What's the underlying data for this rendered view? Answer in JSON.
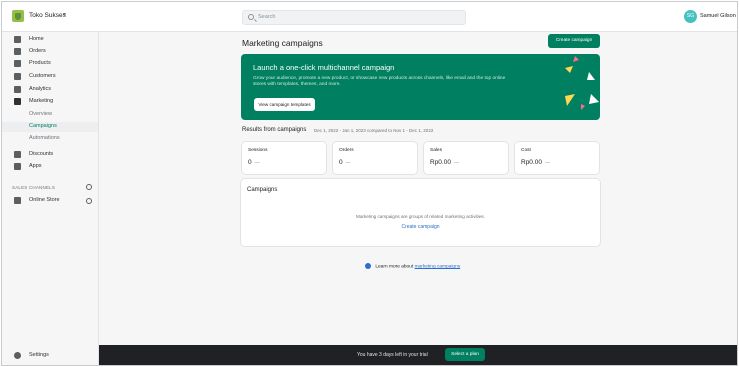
{
  "header": {
    "store_name": "Toko Sukses",
    "store_caret": "▾",
    "search_placeholder": "Search",
    "user_initials": "SG",
    "user_name": "Samuel Gilson"
  },
  "sidebar": {
    "items": [
      {
        "label": "Home",
        "icon": "home-icon"
      },
      {
        "label": "Orders",
        "icon": "orders-icon"
      },
      {
        "label": "Products",
        "icon": "products-icon"
      },
      {
        "label": "Customers",
        "icon": "customers-icon"
      },
      {
        "label": "Analytics",
        "icon": "analytics-icon"
      },
      {
        "label": "Marketing",
        "icon": "marketing-icon"
      },
      {
        "label": "Overview"
      },
      {
        "label": "Campaigns"
      },
      {
        "label": "Automations"
      },
      {
        "label": "Discounts",
        "icon": "discounts-icon"
      },
      {
        "label": "Apps",
        "icon": "apps-icon"
      }
    ],
    "sales_channels_header": "SALES CHANNELS",
    "online_store": "Online Store",
    "settings": "Settings"
  },
  "main": {
    "title": "Marketing campaigns",
    "create_button": "Create campaign",
    "banner": {
      "title": "Launch a one-click multichannel campaign",
      "text": "Grow your audience, promote a new product, or showcase new products across channels, like email and the top online stores with templates, themes, and more.",
      "button": "View campaign templates"
    },
    "results": {
      "title": "Results from campaigns",
      "subtitle": "Dec 1, 2022 - Jan 1, 2023 compared to Nov 1 - Dec 1, 2022"
    },
    "stats": [
      {
        "label": "Sessions",
        "value": "0",
        "delta": "—"
      },
      {
        "label": "Orders",
        "value": "0",
        "delta": "—"
      },
      {
        "label": "Sales",
        "value": "Rp0.00",
        "delta": "—"
      },
      {
        "label": "Cost",
        "value": "Rp0.00",
        "delta": "—"
      }
    ],
    "campaigns": {
      "title": "Campaigns",
      "empty_text": "Marketing campaigns are groups of related marketing activities.",
      "link": "Create campaign"
    },
    "learn_more": {
      "prefix": "Learn more about",
      "link": "marketing campaigns"
    }
  },
  "trial": {
    "text": "You have 3 days left in your trial",
    "button": "Select a plan"
  },
  "colors": {
    "accent": "#008060",
    "link": "#2c6ecb",
    "dark_bar": "#1f2124"
  }
}
